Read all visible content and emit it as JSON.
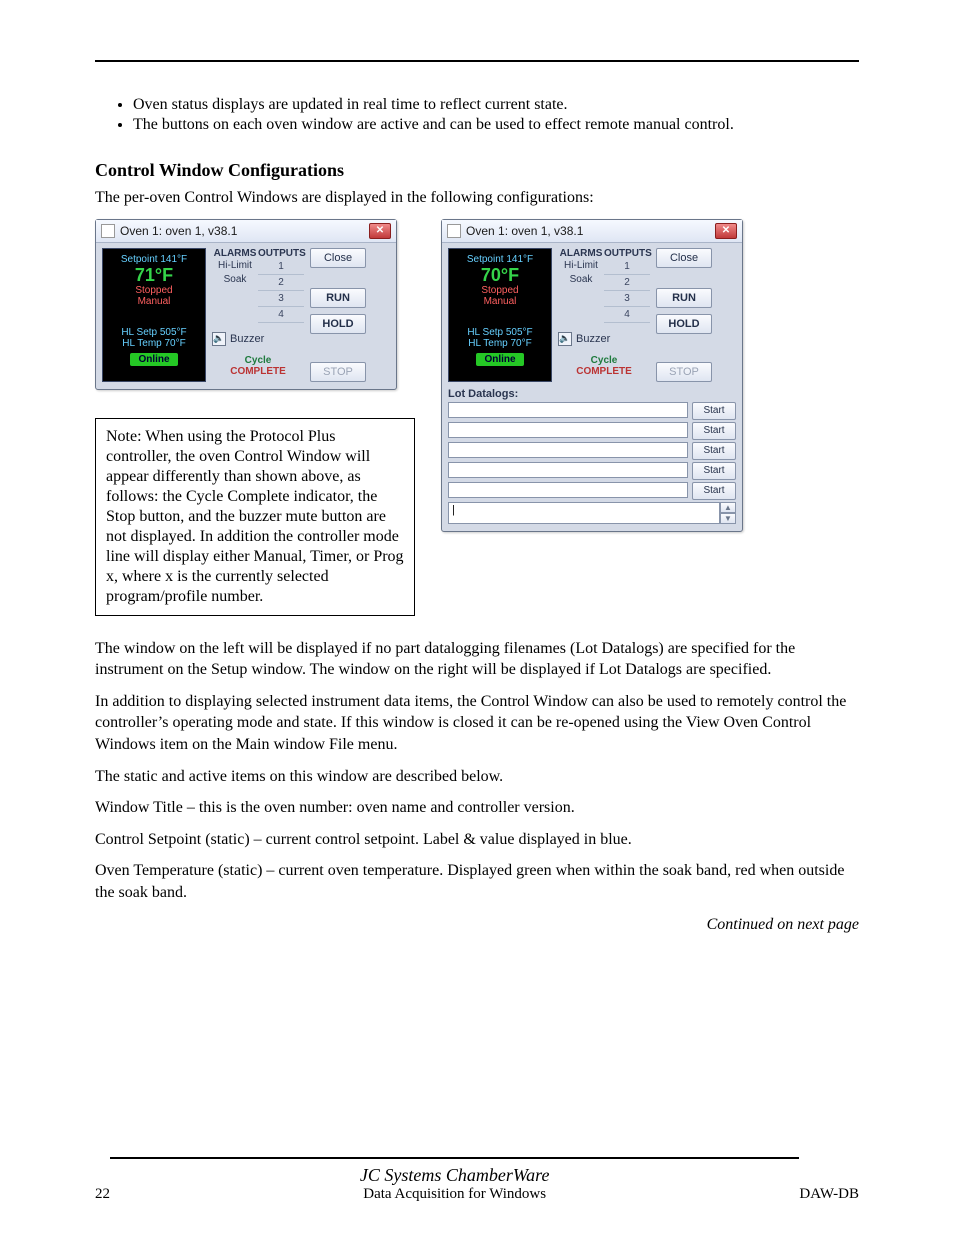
{
  "header_rule": true,
  "bullets": [
    "Oven status displays are updated in real time to reflect current state.",
    "The buttons on each oven window are active and can be used to effect remote manual control."
  ],
  "section_title": "Control Window Configurations",
  "intro_para": "The per-oven Control Windows are displayed in the following configurations:",
  "oven_a": {
    "title": "Oven 1: oven 1, v38.1",
    "panel": {
      "setpoint": "Setpoint 141°F",
      "temp": "71°F",
      "stopped": "Stopped",
      "manual": "Manual",
      "hl_setp": "HL Setp 505°F",
      "hl_temp": "HL Temp 70°F",
      "online": "Online"
    },
    "mid": {
      "alarms": "ALARMS",
      "hi_limit": "Hi-Limit",
      "soak": "Soak",
      "outputs": "OUTPUTS",
      "out": [
        "1",
        "2",
        "3",
        "4"
      ],
      "buzzer": "Buzzer",
      "cycle_a": "Cycle",
      "cycle_b": "COMPLETE"
    },
    "buttons": {
      "close": "Close",
      "run": "RUN",
      "hold": "HOLD",
      "stop": "STOP"
    }
  },
  "oven_b": {
    "title": "Oven 1: oven 1, v38.1",
    "panel": {
      "setpoint": "Setpoint 141°F",
      "temp": "70°F",
      "stopped": "Stopped",
      "manual": "Manual",
      "hl_setp": "HL Setp 505°F",
      "hl_temp": "HL Temp 70°F",
      "online": "Online"
    },
    "mid": {
      "alarms": "ALARMS",
      "hi_limit": "Hi-Limit",
      "soak": "Soak",
      "outputs": "OUTPUTS",
      "out": [
        "1",
        "2",
        "3",
        "4"
      ],
      "buzzer": "Buzzer",
      "cycle_a": "Cycle",
      "cycle_b": "COMPLETE"
    },
    "buttons": {
      "close": "Close",
      "run": "RUN",
      "hold": "HOLD",
      "stop": "STOP"
    },
    "lots": {
      "label": "Lot Datalogs:",
      "start": "Start",
      "cursor": "|"
    }
  },
  "note": {
    "label": "Note:",
    "body": "When using the Protocol Plus controller, the oven Control Window will appear differently than shown above, as follows: the Cycle Complete indicator, the Stop button, and the buzzer mute button are not displayed. In addition the controller mode line will display either Manual, Timer, or Prog x, where x is the currently selected program/profile number."
  },
  "after_figs": [
    "The window on the left will be displayed if no part datalogging filenames (Lot Datalogs) are specified for the instrument on the Setup window. The window on the right will be displayed if Lot Datalogs are specified.",
    "In addition to displaying selected instrument data items, the Control Window can also be used to remotely control the controller’s operating mode and state. If this window is closed it can be re-opened using the View Oven Control Windows item on the Main window File menu.",
    "The static and active items on this window are described below.",
    "Window Title – this is the oven number: oven name and controller version.",
    "Control Setpoint (static) – current control setpoint. Label & value displayed in blue.",
    "Oven Temperature (static) – current oven temperature. Displayed green when within the soak band, red when outside the soak band."
  ],
  "continued": "Continued on next page",
  "footer": {
    "page": "22",
    "title_a": "JC Systems ChamberWare",
    "title_b": "Data Acquisition for Windows",
    "code": "DAW-DB"
  }
}
